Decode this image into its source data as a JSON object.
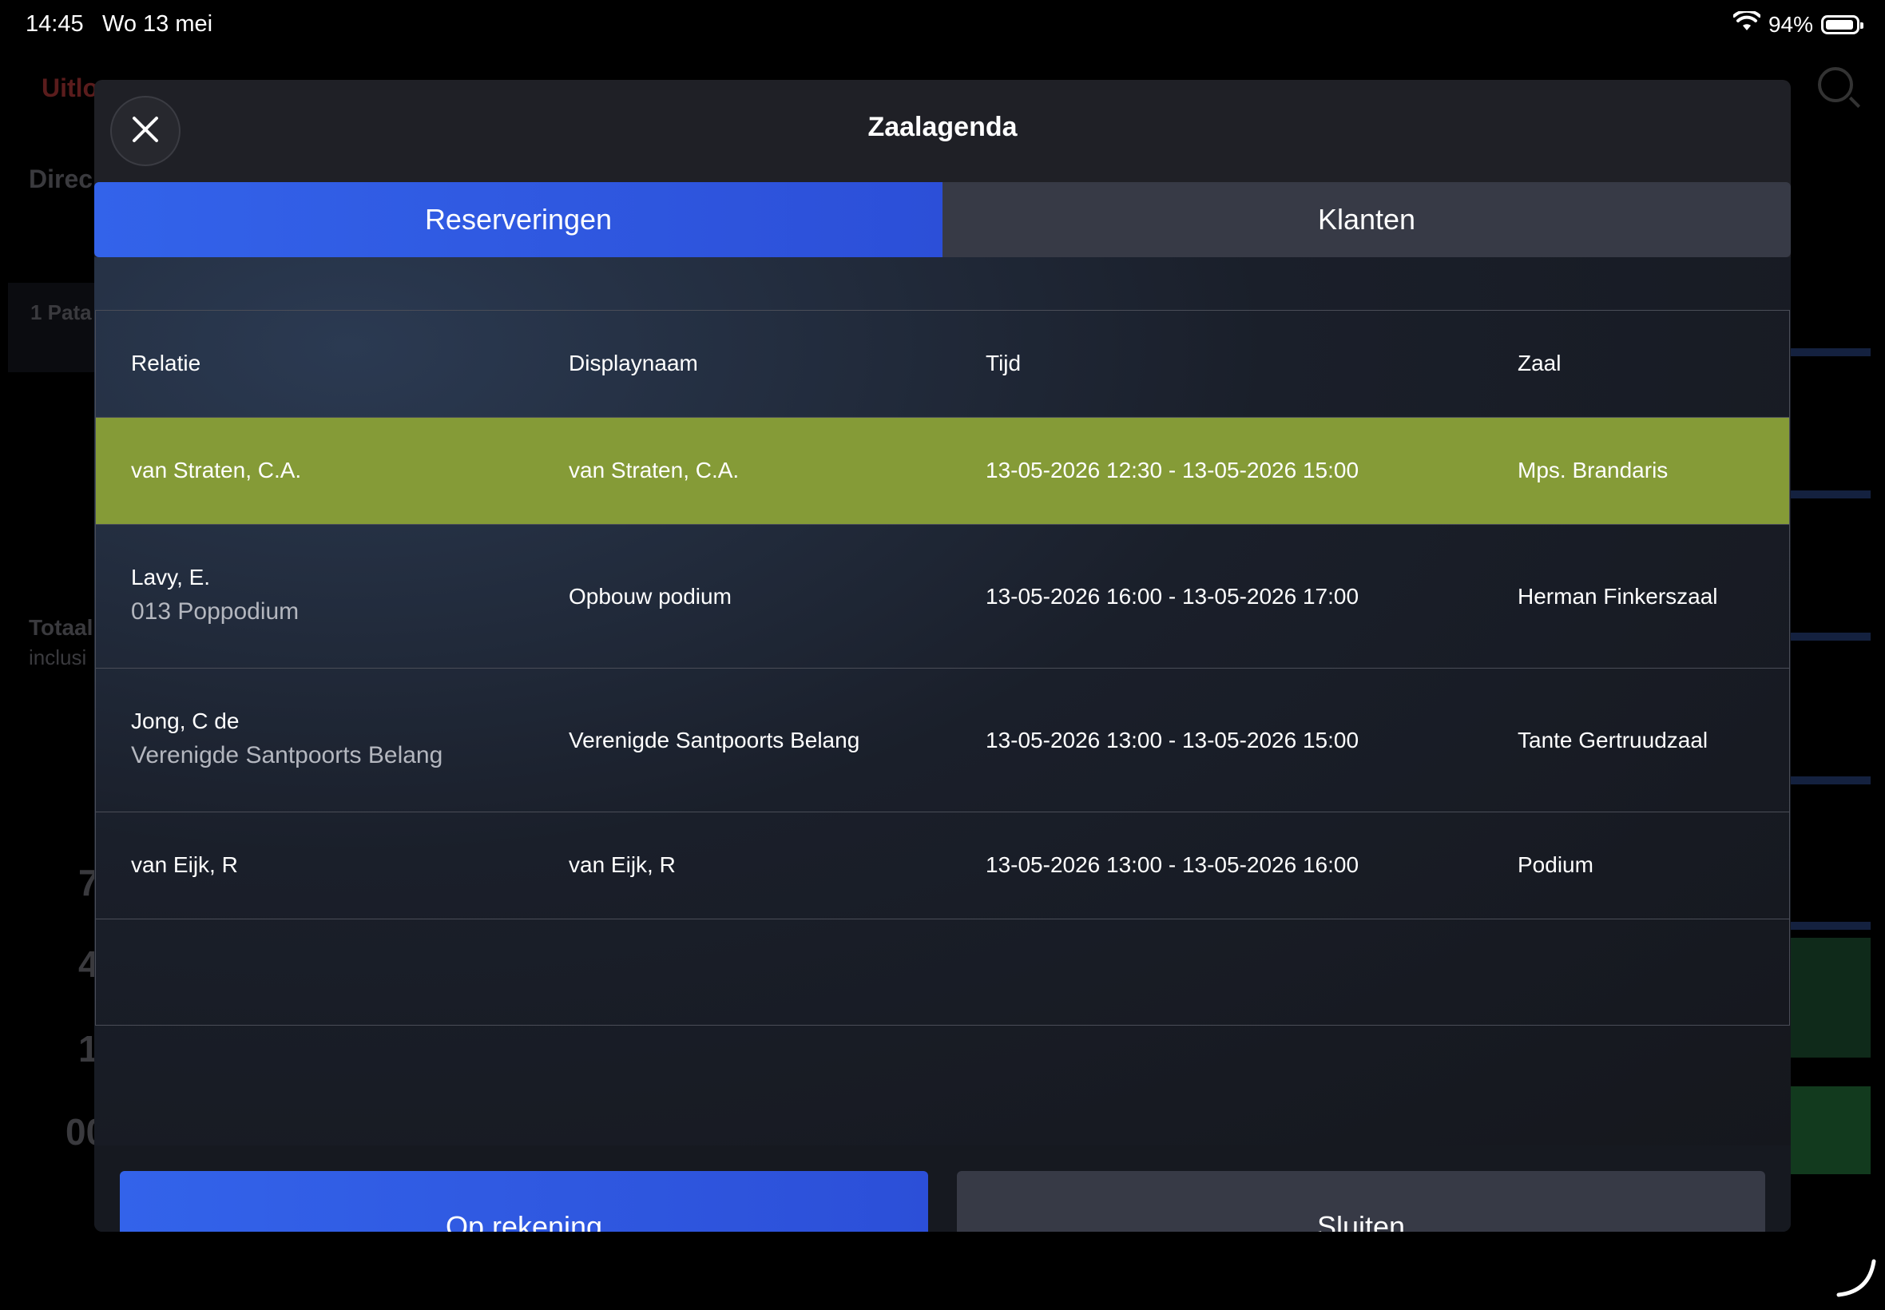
{
  "status_bar": {
    "time": "14:45",
    "date": "Wo 13 mei",
    "battery": "94%",
    "battery_level": 0.94
  },
  "background": {
    "top_left": "Uitlo",
    "section": "Direc",
    "row_item": "1  Pata",
    "total": "Totaal",
    "total_sub": "inclusi",
    "digits": [
      "7",
      "4",
      "1",
      "00"
    ]
  },
  "modal": {
    "title": "Zaalagenda",
    "tabs": [
      {
        "label": "Reserveringen",
        "active": true
      },
      {
        "label": "Klanten",
        "active": false
      }
    ],
    "table": {
      "headers": [
        "Relatie",
        "Displaynaam",
        "Tijd",
        "Zaal"
      ],
      "rows": [
        {
          "relatie": "van Straten, C.A.",
          "relatie_sub": "",
          "displaynaam": "van Straten, C.A.",
          "tijd": "13-05-2026 12:30 - 13-05-2026 15:00",
          "zaal": "Mps. Brandaris",
          "selected": true
        },
        {
          "relatie": "Lavy, E.",
          "relatie_sub": "013 Poppodium",
          "displaynaam": "Opbouw podium",
          "tijd": "13-05-2026 16:00 - 13-05-2026 17:00",
          "zaal": "Herman Finkerszaal",
          "selected": false
        },
        {
          "relatie": "Jong, C de",
          "relatie_sub": "Verenigde Santpoorts Belang",
          "displaynaam": "Verenigde Santpoorts Belang",
          "tijd": "13-05-2026 13:00 - 13-05-2026 15:00",
          "zaal": "Tante Gertruudzaal",
          "selected": false
        },
        {
          "relatie": "van Eijk, R",
          "relatie_sub": "",
          "displaynaam": "van Eijk, R",
          "tijd": "13-05-2026 13:00 - 13-05-2026 16:00",
          "zaal": "Podium",
          "selected": false
        }
      ]
    },
    "buttons": {
      "primary": "Op rekening",
      "secondary": "Sluiten"
    }
  },
  "icons": {
    "close": "close-icon",
    "wifi": "wifi-icon",
    "battery": "battery-icon",
    "search": "search-icon"
  },
  "colors": {
    "accent_blue": "#3363ea",
    "selected_row": "#859b37",
    "modal_bg": "#1f2026",
    "secondary_button": "#373a46"
  }
}
